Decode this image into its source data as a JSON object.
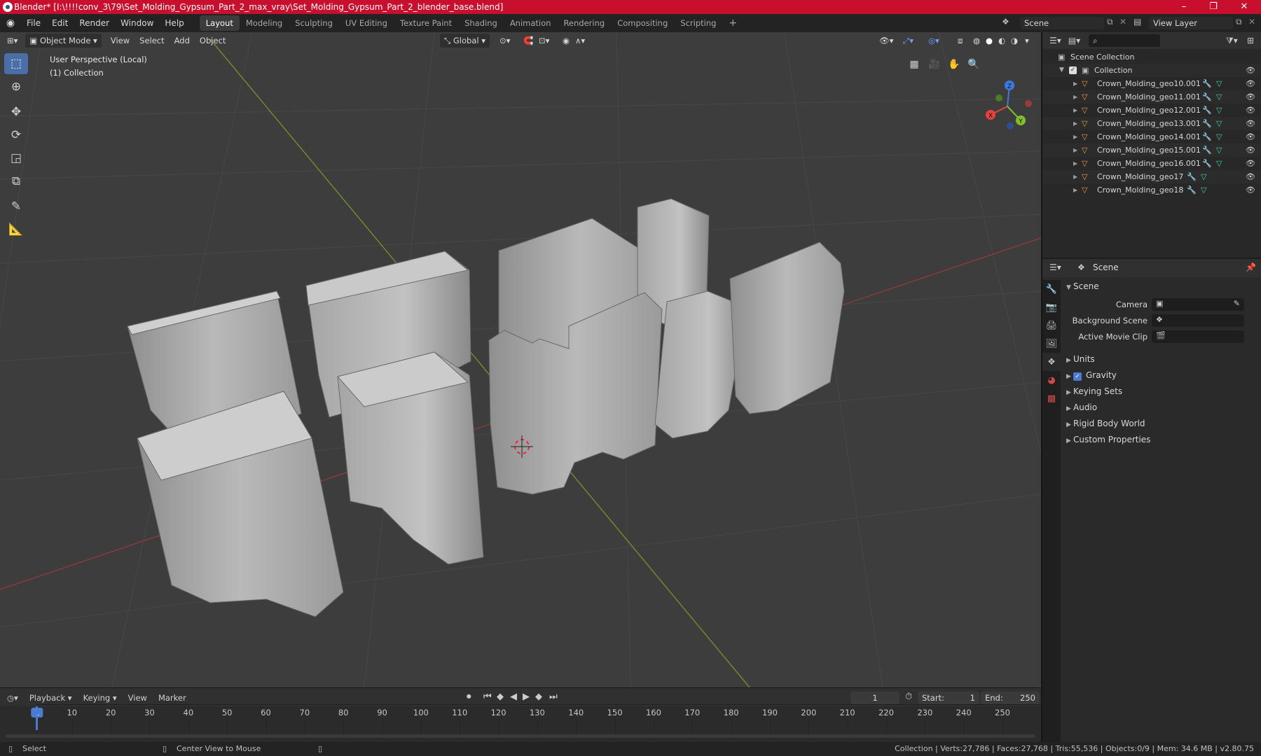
{
  "window": {
    "title": "Blender* [I:\\!!!!conv_3\\79\\Set_Molding_Gypsum_Part_2_max_vray\\Set_Molding_Gypsum_Part_2_blender_base.blend]",
    "minimize": "–",
    "maximize": "❐",
    "close": "✕"
  },
  "menu": {
    "items": [
      "File",
      "Edit",
      "Render",
      "Window",
      "Help"
    ],
    "workspaces": [
      "Layout",
      "Modeling",
      "Sculpting",
      "UV Editing",
      "Texture Paint",
      "Shading",
      "Animation",
      "Rendering",
      "Compositing",
      "Scripting"
    ],
    "active_workspace": "Layout",
    "add_workspace": "+",
    "scene_name": "Scene",
    "view_layer_name": "View Layer"
  },
  "viewport": {
    "mode": "Object Mode",
    "menus": [
      "View",
      "Select",
      "Add",
      "Object"
    ],
    "transform_orientation": "Global",
    "overlay_line1": "User Perspective (Local)",
    "overlay_line2": "(1) Collection",
    "gizmo_axes": {
      "x": "X",
      "y": "Y",
      "z": "Z"
    }
  },
  "timeline": {
    "menus": [
      "Playback",
      "Keying",
      "View",
      "Marker"
    ],
    "current_frame": "1",
    "start_label": "Start:",
    "start": "1",
    "end_label": "End:",
    "end": "250",
    "ticks": [
      "1",
      "10",
      "20",
      "30",
      "40",
      "50",
      "60",
      "70",
      "80",
      "90",
      "100",
      "110",
      "120",
      "130",
      "140",
      "150",
      "160",
      "170",
      "180",
      "190",
      "200",
      "210",
      "220",
      "230",
      "240",
      "250"
    ]
  },
  "status": {
    "select": "Select",
    "center_view": "Center View to Mouse",
    "stats": "Collection | Verts:27,786 | Faces:27,768 | Tris:55,536 | Objects:0/9 | Mem: 34.6 MB | v2.80.75"
  },
  "outliner": {
    "root": "Scene Collection",
    "collection": "Collection",
    "objects": [
      "Crown_Molding_geo10.001",
      "Crown_Molding_geo11.001",
      "Crown_Molding_geo12.001",
      "Crown_Molding_geo13.001",
      "Crown_Molding_geo14.001",
      "Crown_Molding_geo15.001",
      "Crown_Molding_geo16.001",
      "Crown_Molding_geo17",
      "Crown_Molding_geo18"
    ]
  },
  "properties": {
    "context": "Scene",
    "panel_title": "Scene",
    "camera_label": "Camera",
    "background_scene_label": "Background Scene",
    "active_movie_clip_label": "Active Movie Clip",
    "panels": [
      "Units",
      "Gravity",
      "Keying Sets",
      "Audio",
      "Rigid Body World",
      "Custom Properties"
    ]
  },
  "colors": {
    "title_bar": "#c8102e",
    "active_tool": "#4b6ea8",
    "axis_x": "#e8413c",
    "axis_y": "#7fbf2e",
    "axis_z": "#3a7be0",
    "frame_marker": "#4a7bd0",
    "object_icon": "#e69b3c"
  }
}
